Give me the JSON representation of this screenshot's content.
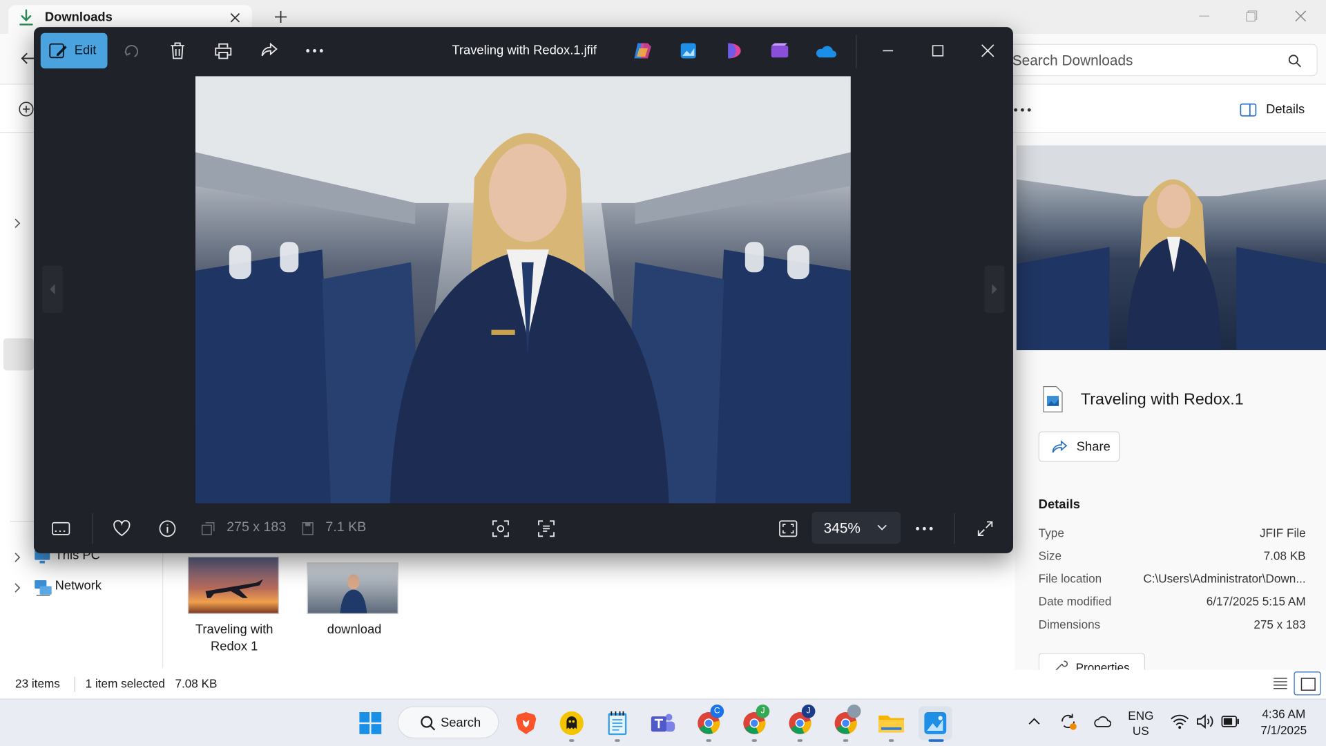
{
  "explorer": {
    "tab_title": "Downloads",
    "search_placeholder": "Search Downloads",
    "details_toggle": "Details",
    "nav": {
      "this_pc": "This PC",
      "network": "Network"
    },
    "files": [
      {
        "name_line1": "Traveling with",
        "name_line2": "Redox 1"
      },
      {
        "name_line1": "download",
        "name_line2": ""
      }
    ],
    "status": {
      "count": "23 items",
      "selected": "1 item selected",
      "size": "7.08 KB"
    },
    "details_pane": {
      "file_title": "Traveling with Redox.1",
      "share_label": "Share",
      "section": "Details",
      "rows": [
        {
          "key": "Type",
          "value": "JFIF File"
        },
        {
          "key": "Size",
          "value": "7.08 KB"
        },
        {
          "key": "File location",
          "value": "C:\\Users\\Administrator\\Down..."
        },
        {
          "key": "Date modified",
          "value": "6/17/2025 5:15 AM"
        },
        {
          "key": "Dimensions",
          "value": "275 x 183"
        }
      ],
      "properties_label": "Properties"
    }
  },
  "viewer": {
    "edit_label": "Edit",
    "title": "Traveling with Redox.1.jfif",
    "dimensions": "275 x 183",
    "file_size": "7.1 KB",
    "zoom": "345%"
  },
  "taskbar": {
    "search_label": "Search",
    "lang_line1": "ENG",
    "lang_line2": "US",
    "time": "4:36 AM",
    "date": "7/1/2025",
    "chrome_profiles": [
      "C",
      "J",
      "J"
    ]
  },
  "colors": {
    "accent": "#4aa3df",
    "viewer_bg": "#1f2329",
    "uniform": "#1c2c52"
  }
}
